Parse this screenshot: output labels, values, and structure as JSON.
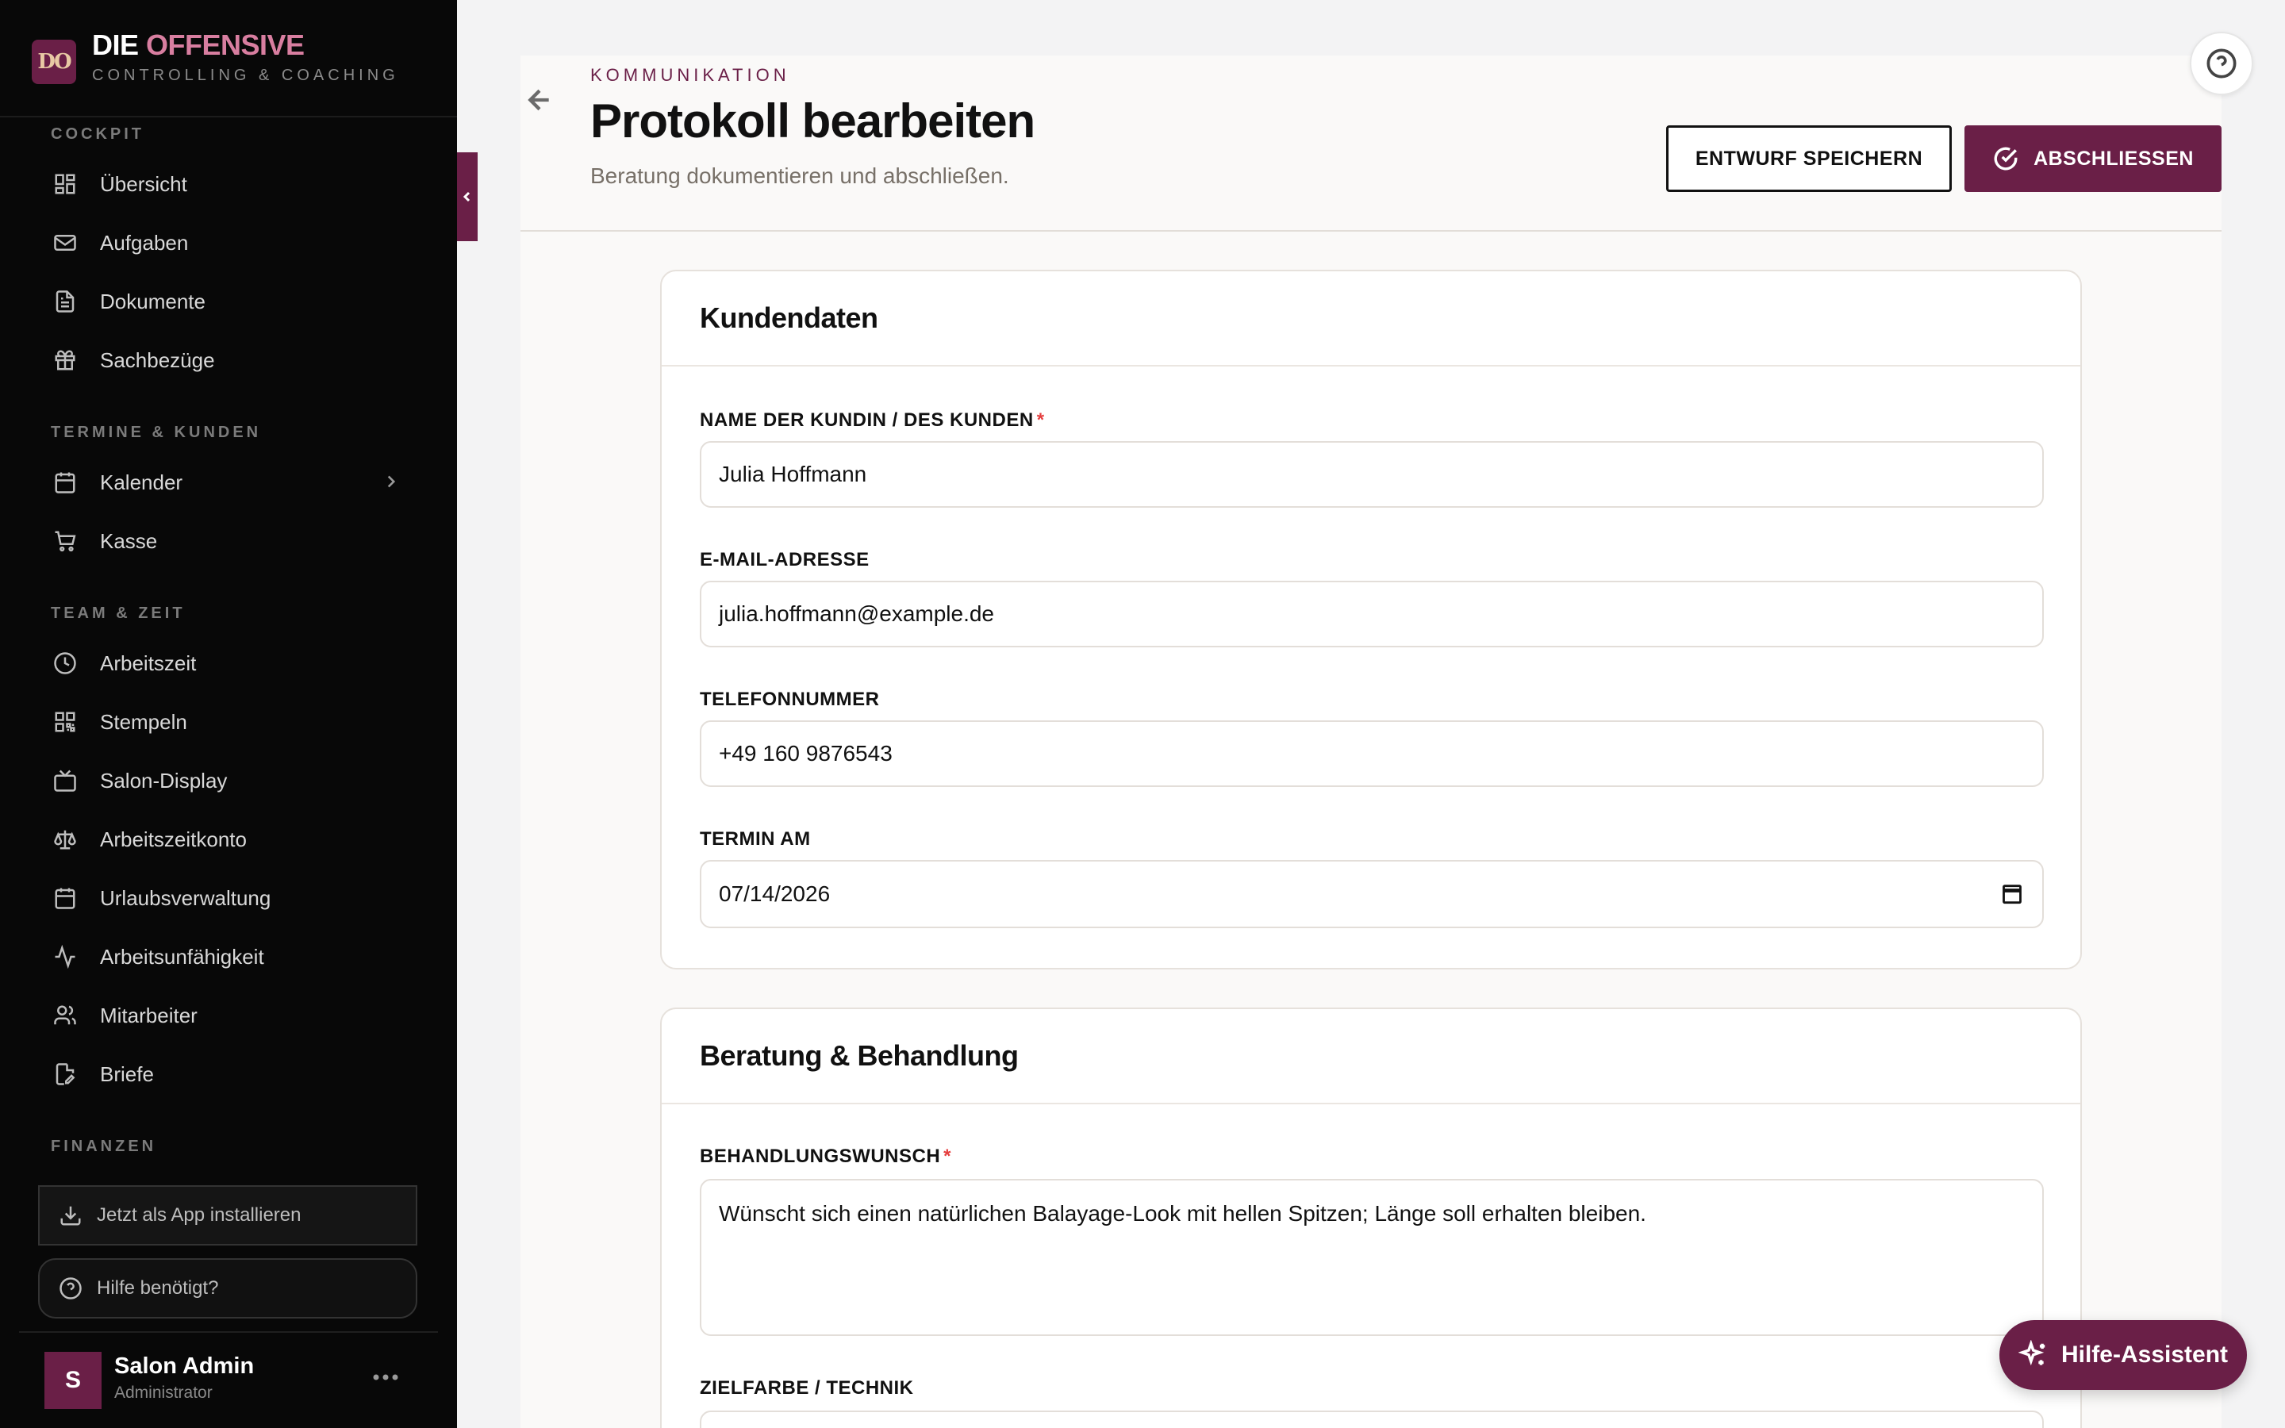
{
  "brand": {
    "logo_text": "DO",
    "title_part1": "DIE",
    "title_part2": "OFFENSIVE",
    "subtitle": "CONTROLLING & COACHING"
  },
  "sidebar": {
    "sections": [
      {
        "label": "COCKPIT"
      },
      {
        "label": "TERMINE & KUNDEN"
      },
      {
        "label": "TEAM & ZEIT"
      },
      {
        "label": "FINANZEN"
      }
    ],
    "items": [
      {
        "label": "Übersicht",
        "icon": "dashboard-icon"
      },
      {
        "label": "Aufgaben",
        "icon": "mail-icon"
      },
      {
        "label": "Dokumente",
        "icon": "document-icon"
      },
      {
        "label": "Sachbezüge",
        "icon": "gift-icon"
      },
      {
        "label": "Kalender",
        "icon": "calendar-icon"
      },
      {
        "label": "Kasse",
        "icon": "cart-icon"
      },
      {
        "label": "Arbeitszeit",
        "icon": "clock-icon"
      },
      {
        "label": "Stempeln",
        "icon": "qr-code-icon"
      },
      {
        "label": "Salon-Display",
        "icon": "tv-icon"
      },
      {
        "label": "Arbeitszeitkonto",
        "icon": "scale-icon"
      },
      {
        "label": "Urlaubsverwaltung",
        "icon": "calendar-icon"
      },
      {
        "label": "Arbeitsunfähigkeit",
        "icon": "activity-icon"
      },
      {
        "label": "Mitarbeiter",
        "icon": "users-icon"
      },
      {
        "label": "Briefe",
        "icon": "edit-document-icon"
      }
    ],
    "install_label": "Jetzt als App installieren",
    "help_label": "Hilfe benötigt?",
    "user": {
      "initial": "S",
      "name": "Salon Admin",
      "role": "Administrator"
    }
  },
  "header": {
    "eyebrow": "KOMMUNIKATION",
    "title": "Protokoll bearbeiten",
    "subtitle": "Beratung dokumentieren und abschließen.",
    "draft_label": "ENTWURF SPEICHERN",
    "finish_label": "ABSCHLIESSEN"
  },
  "customer_card": {
    "title": "Kundendaten",
    "name_label": "NAME DER KUNDIN / DES KUNDEN",
    "name_value": "Julia Hoffmann",
    "email_label": "E-MAIL-ADRESSE",
    "email_value": "julia.hoffmann@example.de",
    "phone_label": "TELEFONNUMMER",
    "phone_value": "+49 160 9876543",
    "date_label": "TERMIN AM",
    "date_value": "07/14/2026"
  },
  "treatment_card": {
    "title": "Beratung & Behandlung",
    "wish_label": "BEHANDLUNGSWUNSCH",
    "wish_value": "Wünscht sich einen natürlichen Balayage-Look mit hellen Spitzen; Länge soll erhalten bleiben.",
    "color_label": "ZIELFARBE / TECHNIK"
  },
  "assistant": {
    "label": "Hilfe-Assistent"
  },
  "colors": {
    "brand": "#6a1f47",
    "brand_accent": "#d87ea0",
    "sidebar_bg": "#080808",
    "required": "#e53e3e"
  }
}
